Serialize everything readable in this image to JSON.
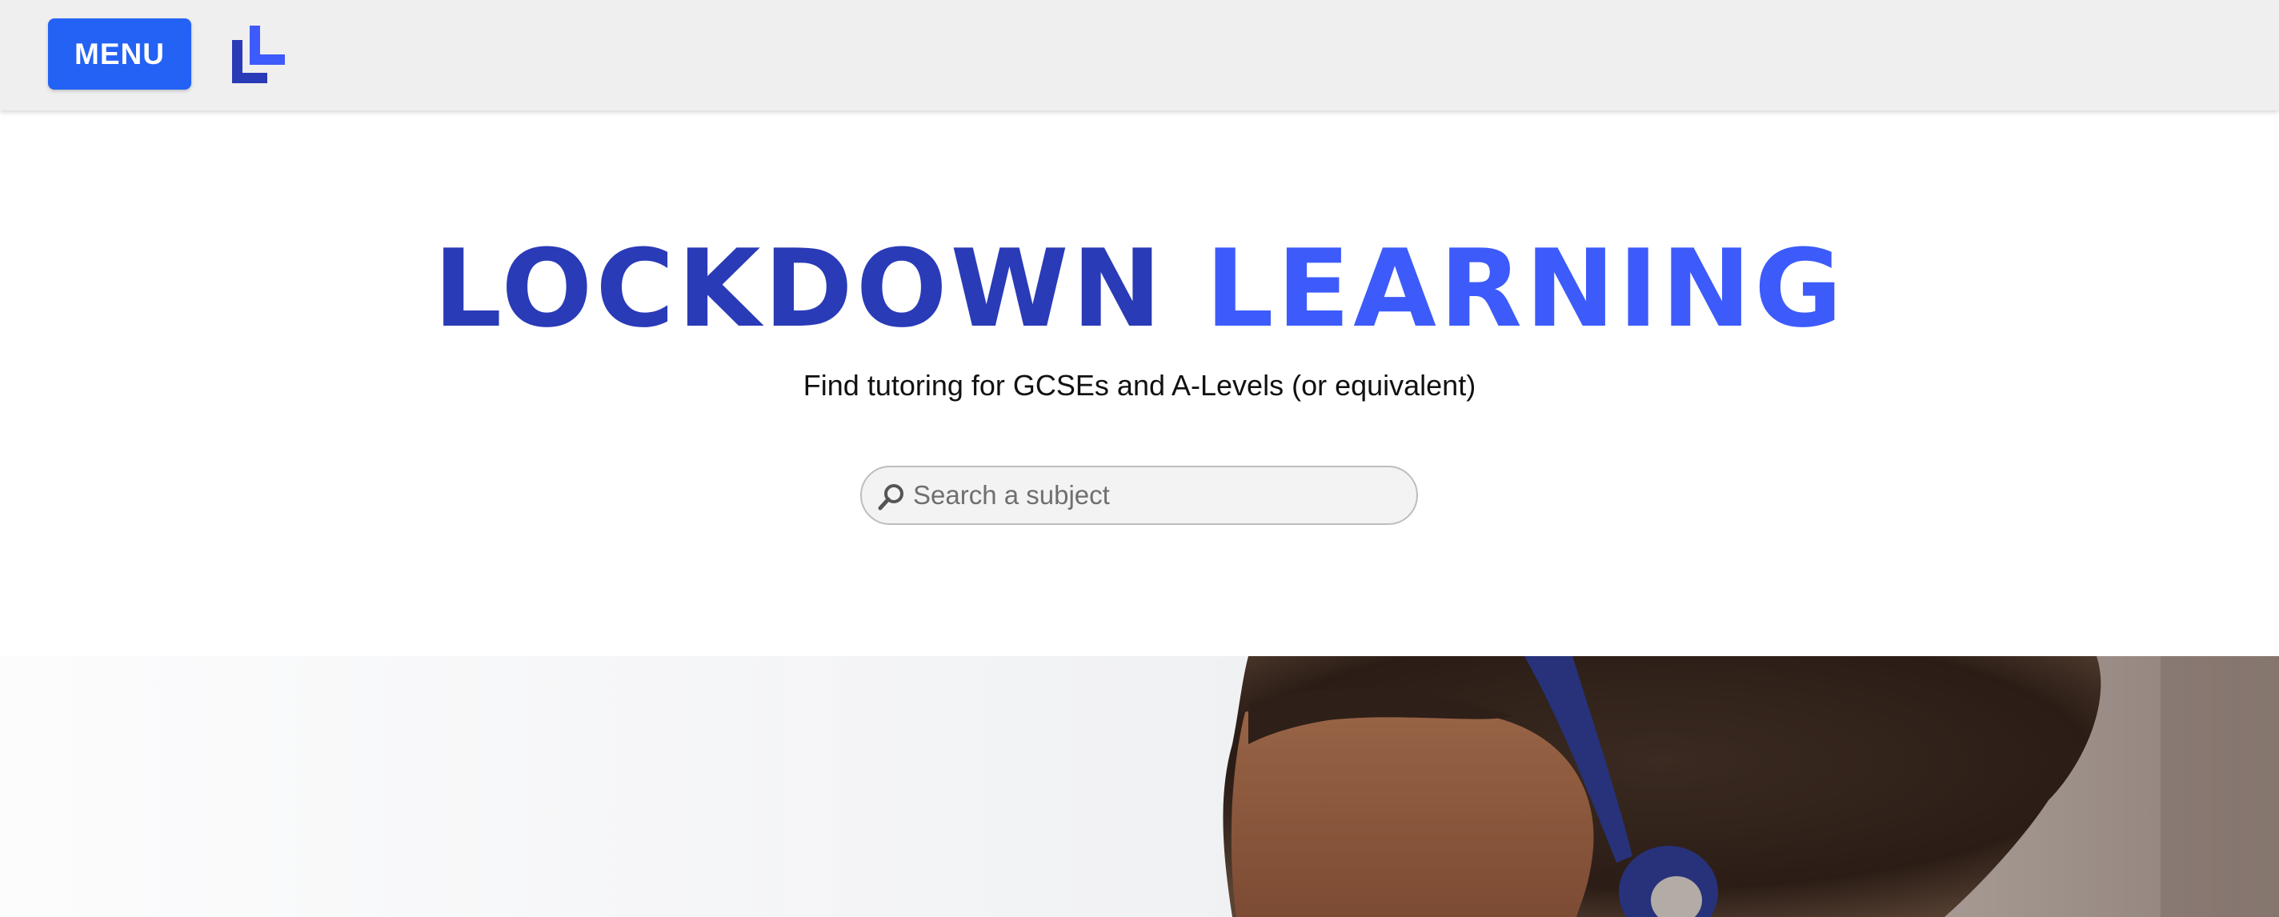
{
  "header": {
    "menu_label": "MENU",
    "logo_icon": "lockdown-learning-logo-icon",
    "colors": {
      "bar": "#efefef",
      "button": "#2362f5"
    }
  },
  "hero": {
    "title_word1": "LOCKDOWN",
    "title_word2": "LEARNING",
    "subtitle": "Find tutoring for GCSEs and A-Levels (or equivalent)",
    "colors": {
      "title_dark": "#2a3bb7",
      "title_light": "#3d5bfa"
    }
  },
  "search": {
    "placeholder": "Search a subject",
    "value": "",
    "icon": "search-icon"
  },
  "banner": {
    "image": "student-with-headphones-photo"
  }
}
